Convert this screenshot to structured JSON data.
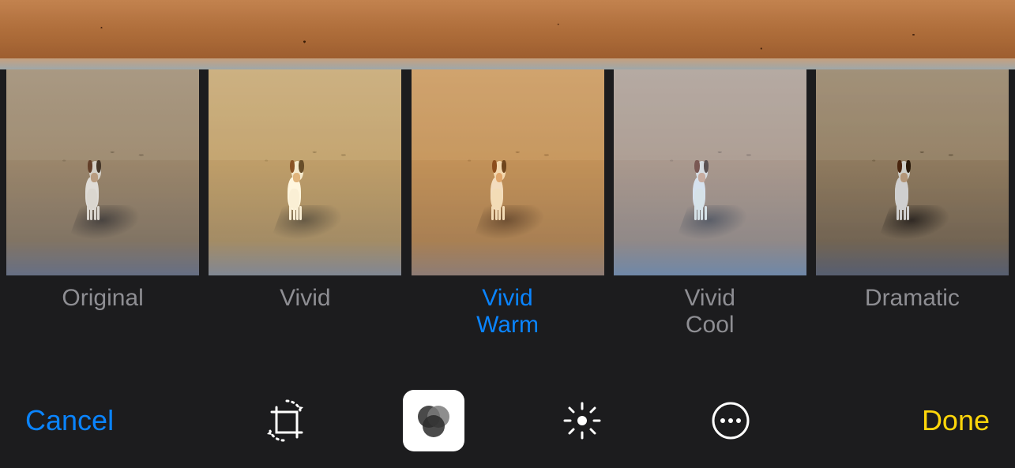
{
  "colors": {
    "accent_blue": "#0a84ff",
    "done_yellow": "#ffd60a",
    "muted_label": "#8e8e93",
    "bg": "#1c1c1e"
  },
  "preview": {
    "description": "beach sand with warm tone applied"
  },
  "filters": {
    "selected_index": 2,
    "items": [
      {
        "id": "original",
        "label": "Original",
        "css": "f-original"
      },
      {
        "id": "vivid",
        "label": "Vivid",
        "css": "f-vivid"
      },
      {
        "id": "vivid_warm",
        "label": "Vivid\nWarm",
        "css": "f-vividwarm"
      },
      {
        "id": "vivid_cool",
        "label": "Vivid\nCool",
        "css": "f-vividcool"
      },
      {
        "id": "dramatic",
        "label": "Dramatic",
        "css": "f-dramatic"
      }
    ]
  },
  "toolbar": {
    "cancel_label": "Cancel",
    "done_label": "Done",
    "tools": [
      {
        "id": "crop",
        "name": "crop-rotate-icon",
        "active": false
      },
      {
        "id": "filters",
        "name": "filters-icon",
        "active": true
      },
      {
        "id": "adjust",
        "name": "adjust-icon",
        "active": false
      },
      {
        "id": "more",
        "name": "more-icon",
        "active": false
      }
    ]
  }
}
